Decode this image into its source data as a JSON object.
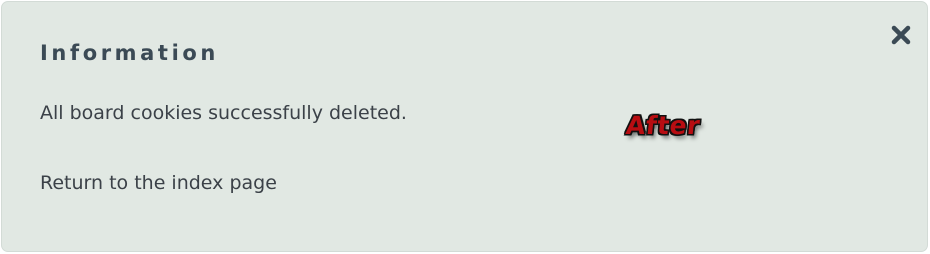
{
  "dialog": {
    "title": "Information",
    "message": "All board cookies successfully deleted.",
    "return_link": "Return to the index page",
    "close_icon": "close-icon"
  },
  "overlay": {
    "label": "After"
  },
  "colors": {
    "panel_background": "#e1e8e3",
    "title_text": "#3b4a55",
    "body_text": "#3b4148",
    "close_icon": "#3b4a55",
    "overlay_red": "#b80d12"
  }
}
